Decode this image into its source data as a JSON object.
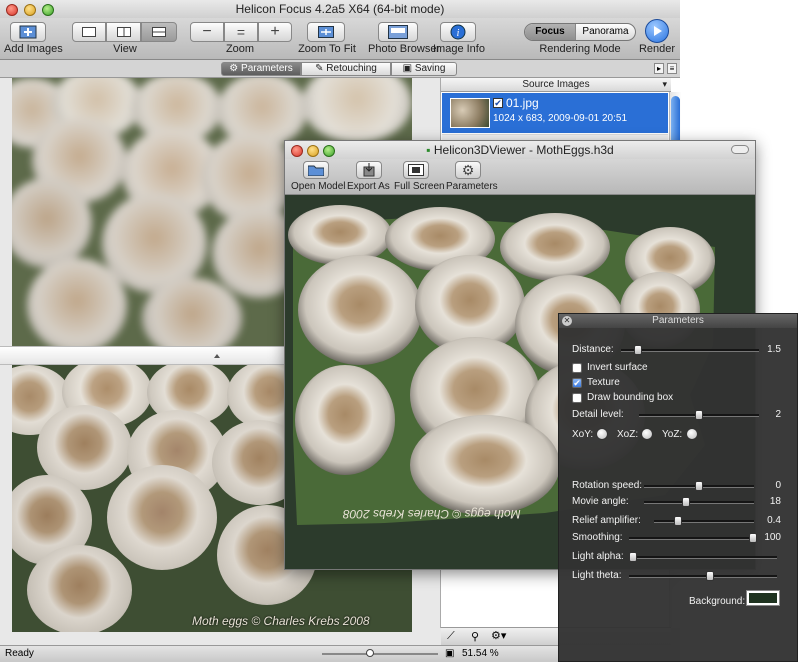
{
  "main": {
    "title": "Helicon Focus 4.2a5 X64 (64-bit mode)",
    "toolbar": {
      "add_images": "Add Images",
      "view": "View",
      "zoom": "Zoom",
      "zoom_to_fit": "Zoom To Fit",
      "photo_browser": "Photo Browser",
      "image_info": "Image Info",
      "mode_focus": "Focus",
      "mode_panorama": "Panorama",
      "rendering_mode": "Rendering Mode",
      "render": "Render"
    },
    "tabs": [
      {
        "label": "Parameters",
        "selected": true
      },
      {
        "label": "Retouching",
        "selected": false
      },
      {
        "label": "Saving",
        "selected": false
      }
    ],
    "source_images": {
      "header": "Source Images",
      "items": [
        {
          "name": "01.jpg",
          "info": "1024 x 683, 2009-09-01 20:51",
          "checked": true
        }
      ]
    },
    "watermark": "Moth eggs © Charles Krebs 2008",
    "status": {
      "text": "Ready",
      "zoom": "51.54 %"
    }
  },
  "viewer": {
    "title": "Helicon3DViewer - MothEggs.h3d",
    "toolbar": {
      "open_model": "Open Model",
      "export_as": "Export As",
      "full_screen": "Full Screen",
      "parameters": "Parameters"
    },
    "mirrored_watermark": "Moth eggs © Charles Krebs 2008"
  },
  "params": {
    "title": "Parameters",
    "distance": {
      "label": "Distance:",
      "value": "1.5",
      "fraction": 0.1
    },
    "invert_surface": {
      "label": "Invert surface",
      "checked": false
    },
    "texture": {
      "label": "Texture",
      "checked": true
    },
    "bounding_box": {
      "label": "Draw bounding box",
      "checked": false
    },
    "detail_level": {
      "label": "Detail level:",
      "value": "2",
      "fraction": 0.5
    },
    "xoy": "XoY:",
    "xoz": "XoZ:",
    "yoz": "YoZ:",
    "rotation_speed": {
      "label": "Rotation speed:",
      "value": "0",
      "fraction": 0.5
    },
    "movie_angle": {
      "label": "Movie angle:",
      "value": "18",
      "fraction": 0.37
    },
    "relief_amplifier": {
      "label": "Relief amplifier:",
      "value": "0.4",
      "fraction": 0.22
    },
    "smoothing": {
      "label": "Smoothing:",
      "value": "100",
      "fraction": 1.0
    },
    "light_alpha": {
      "label": "Light alpha:",
      "fraction": 0.0
    },
    "light_theta": {
      "label": "Light theta:",
      "fraction": 0.55
    },
    "background": {
      "label": "Background:",
      "color": "#1f3320"
    }
  },
  "colors": {
    "selection": "#2a6fd6",
    "render_button": "#2a74e0"
  }
}
